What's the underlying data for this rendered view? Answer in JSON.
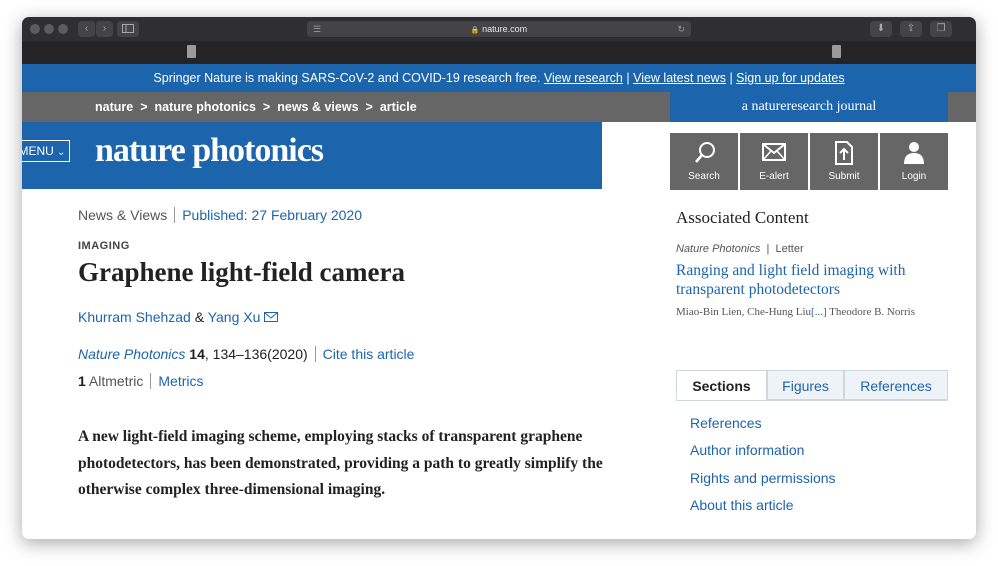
{
  "browser": {
    "url": "nature.com"
  },
  "banner": {
    "text": "Springer Nature is making SARS-CoV-2 and COVID-19 research free.",
    "links": [
      "View research",
      "View latest news",
      "Sign up for updates"
    ],
    "separator": "|"
  },
  "breadcrumb": {
    "items": [
      "nature",
      "nature photonics",
      "news & views",
      "article"
    ],
    "separator": ">"
  },
  "header": {
    "menu_label": "MENU",
    "logo": "nature photonics",
    "tagline": "a natureresearch journal"
  },
  "tools": [
    {
      "label": "Search",
      "icon": "search-icon"
    },
    {
      "label": "E-alert",
      "icon": "envelope-icon"
    },
    {
      "label": "Submit",
      "icon": "upload-icon"
    },
    {
      "label": "Login",
      "icon": "user-icon"
    }
  ],
  "article": {
    "type": "News & Views",
    "published": "Published: 27 February 2020",
    "subject": "IMAGING",
    "title": "Graphene light-field camera",
    "authors": [
      "Khurram Shehzad",
      "Yang Xu"
    ],
    "author_joiner": "&",
    "journal": "Nature Photonics",
    "volume": "14",
    "pages": ", 134–136",
    "year": "(2020)",
    "cite_label": "Cite this article",
    "altmetric_count": "1",
    "altmetric_label": "Altmetric",
    "metrics_label": "Metrics",
    "abstract": "A new light-field imaging scheme, employing stacks of transparent graphene photodetectors, has been demonstrated, providing a path to greatly simplify the otherwise complex three-dimensional imaging."
  },
  "associated": {
    "heading": "Associated Content",
    "journal": "Nature Photonics",
    "separator": "|",
    "type": "Letter",
    "title": "Ranging and light field imaging with transparent photodetectors",
    "authors_start": "Miao-Bin Lien, Che-Hung Liu",
    "authors_more": "[...]",
    "authors_end": " Theodore B. Norris"
  },
  "sections_panel": {
    "tabs": [
      "Sections",
      "Figures",
      "References"
    ],
    "active_tab": "Sections",
    "items": [
      "References",
      "Author information",
      "Rights and permissions",
      "About this article"
    ]
  },
  "colors": {
    "brand_blue": "#1c64ac",
    "bar_grey": "#666666",
    "link": "#1c64ac"
  }
}
